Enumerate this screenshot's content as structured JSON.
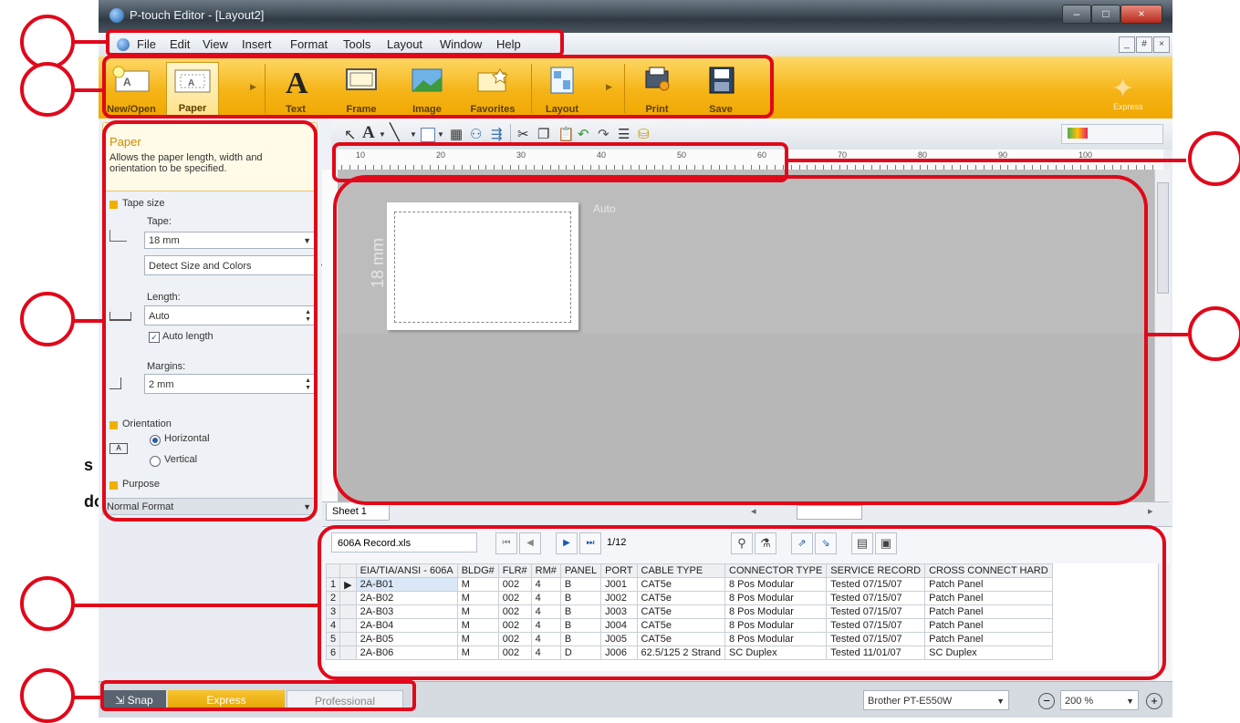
{
  "window": {
    "title": "P-touch Editor - [Layout2]",
    "min": "–",
    "max": "□",
    "close": "×"
  },
  "menubar": {
    "items": [
      "File",
      "Edit",
      "View",
      "Insert",
      "Format",
      "Tools",
      "Layout",
      "Window",
      "Help"
    ],
    "mdi": [
      "_",
      "#",
      "×"
    ]
  },
  "ribbon": {
    "buttons": [
      "New/Open",
      "Paper",
      "Text",
      "Frame",
      "Image",
      "Favorites",
      "Layout",
      "Print",
      "Save"
    ],
    "right_label": "Express"
  },
  "drawbar": {
    "font_letter": "A"
  },
  "leftpanel": {
    "title": "Paper",
    "description": "Allows the paper length, width and orientation to be specified.",
    "tape_size_label": "Tape size",
    "tape_label": "Tape:",
    "tape_value": "18 mm",
    "detect_value": "Detect Size and Colors",
    "length_label": "Length:",
    "length_value": "Auto",
    "auto_length_label": "Auto length",
    "margins_label": "Margins:",
    "margins_value": "2 mm",
    "orientation_label": "Orientation",
    "horizontal_label": "Horizontal",
    "vertical_label": "Vertical",
    "purpose_label": "Purpose",
    "purpose_value": "Normal Format"
  },
  "canvas": {
    "length_label": "Auto",
    "tape_label": "18 mm",
    "ruler_numbers": [
      "10",
      "20",
      "30",
      "40",
      "50",
      "60",
      "70",
      "80",
      "90",
      "100"
    ]
  },
  "sheetbar": {
    "tab": "Sheet 1"
  },
  "database": {
    "file": "606A Record.xls",
    "page": "1/12",
    "columns": [
      "",
      "",
      "EIA/TIA/ANSI - 606A",
      "BLDG#",
      "FLR#",
      "RM#",
      "PANEL",
      "PORT",
      "CABLE TYPE",
      "CONNECTOR TYPE",
      "SERVICE RECORD",
      "CROSS CONNECT HARD"
    ],
    "rows": [
      [
        "1",
        "▶",
        "2A-B01",
        "M",
        "002",
        "4",
        "B",
        "J001",
        "CAT5e",
        "8 Pos Modular",
        "Tested 07/15/07",
        "Patch Panel"
      ],
      [
        "2",
        "",
        "2A-B02",
        "M",
        "002",
        "4",
        "B",
        "J002",
        "CAT5e",
        "8 Pos Modular",
        "Tested 07/15/07",
        "Patch Panel"
      ],
      [
        "3",
        "",
        "2A-B03",
        "M",
        "002",
        "4",
        "B",
        "J003",
        "CAT5e",
        "8 Pos Modular",
        "Tested 07/15/07",
        "Patch Panel"
      ],
      [
        "4",
        "",
        "2A-B04",
        "M",
        "002",
        "4",
        "B",
        "J004",
        "CAT5e",
        "8 Pos Modular",
        "Tested 07/15/07",
        "Patch Panel"
      ],
      [
        "5",
        "",
        "2A-B05",
        "M",
        "002",
        "4",
        "B",
        "J005",
        "CAT5e",
        "8 Pos Modular",
        "Tested 07/15/07",
        "Patch Panel"
      ],
      [
        "6",
        "",
        "2A-B06",
        "M",
        "002",
        "4",
        "D",
        "J006",
        "62.5/125 2 Strand",
        "SC Duplex",
        "Tested 11/01/07",
        "SC Duplex"
      ]
    ]
  },
  "status": {
    "snap": "Snap",
    "express": "Express",
    "professional": "Professional",
    "printer": "Brother PT-E550W",
    "zoom": "200 %"
  },
  "annotations": {
    "outside_text": [
      "s",
      "do"
    ]
  }
}
